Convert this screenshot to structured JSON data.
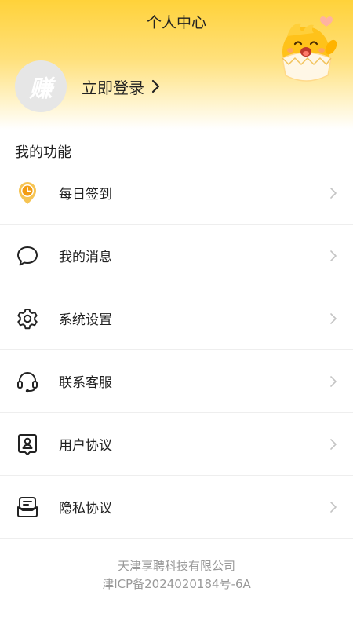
{
  "header": {
    "title": "个人中心",
    "avatar_text": "赚",
    "login_label": "立即登录",
    "accent_color": "#ffd23a"
  },
  "section": {
    "title": "我的功能"
  },
  "menu": {
    "items": [
      {
        "label": "每日签到",
        "icon": "checkin-clock-icon"
      },
      {
        "label": "我的消息",
        "icon": "message-bubble-icon"
      },
      {
        "label": "系统设置",
        "icon": "gear-icon"
      },
      {
        "label": "联系客服",
        "icon": "headset-icon"
      },
      {
        "label": "用户协议",
        "icon": "user-agreement-icon"
      },
      {
        "label": "隐私协议",
        "icon": "privacy-agreement-icon"
      }
    ]
  },
  "footer": {
    "company": "天津享聘科技有限公司",
    "icp": "津ICP备2024020184号-6A"
  }
}
